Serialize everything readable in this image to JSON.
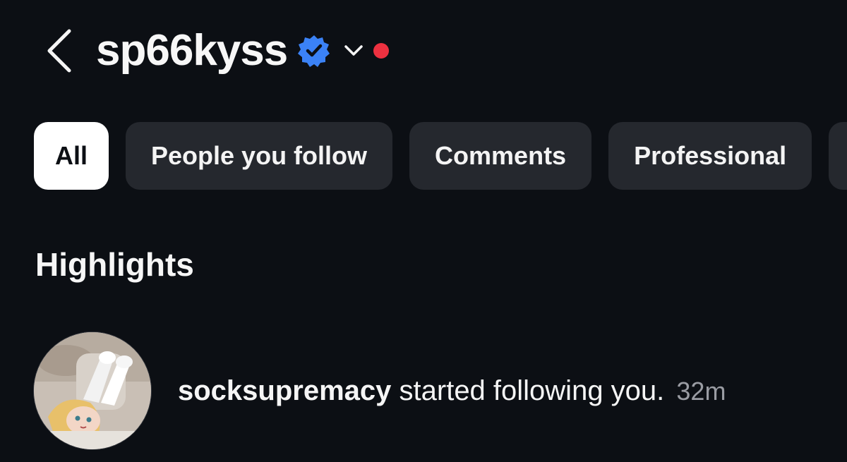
{
  "header": {
    "username": "sp66kyss",
    "icons": {
      "back": "chevron-left-icon",
      "verified": "verified-badge-icon",
      "switcher": "chevron-down-icon"
    },
    "colors": {
      "verified": "#3b82f6",
      "notification_dot": "#ed3140"
    }
  },
  "tabs": [
    {
      "label": "All",
      "active": true
    },
    {
      "label": "People you follow",
      "active": false
    },
    {
      "label": "Comments",
      "active": false
    },
    {
      "label": "Professional",
      "active": false
    }
  ],
  "section": {
    "title": "Highlights"
  },
  "notification": {
    "username": "socksupremacy",
    "message": " started following you.",
    "time": "32m"
  },
  "theme": {
    "background": "#0c0f14",
    "tab_background": "#25282e",
    "active_tab_background": "#ffffff"
  }
}
